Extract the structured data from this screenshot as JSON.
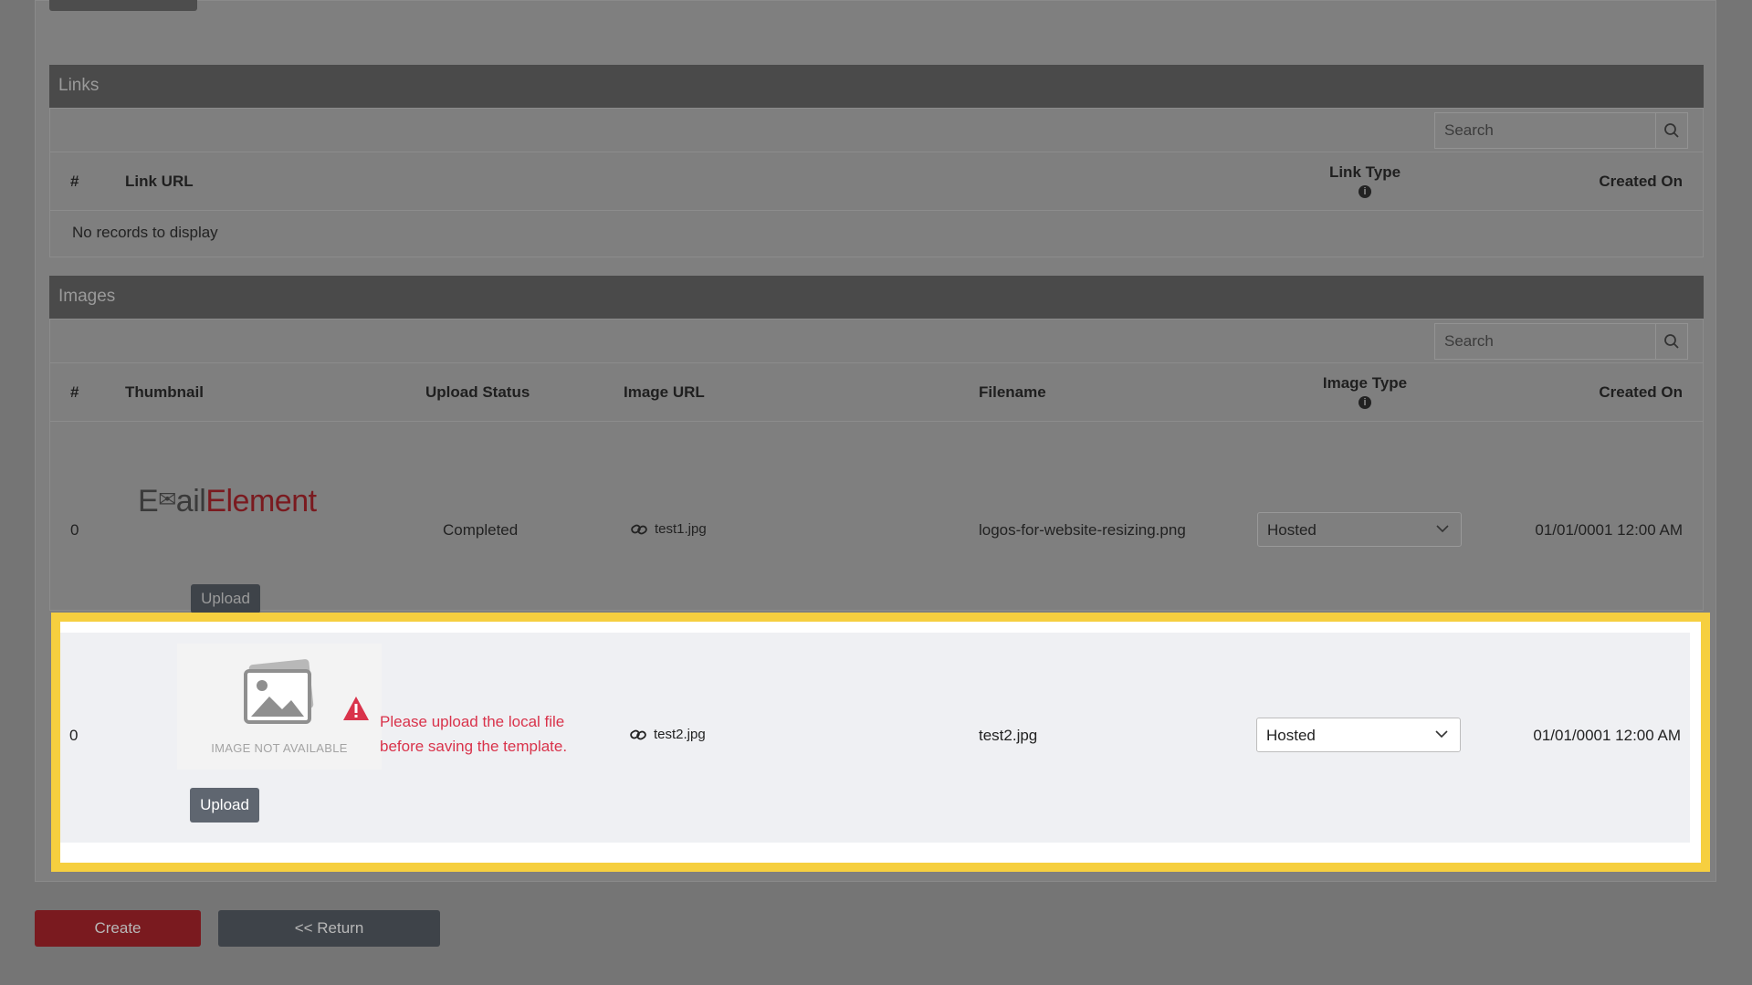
{
  "links_section": {
    "title": "Links",
    "search_placeholder": "Search",
    "columns": {
      "num": "#",
      "url": "Link URL",
      "type": "Link Type",
      "created": "Created On"
    },
    "empty_text": "No records to display"
  },
  "images_section": {
    "title": "Images",
    "search_placeholder": "Search",
    "columns": {
      "num": "#",
      "thumbnail": "Thumbnail",
      "status": "Upload Status",
      "url": "Image URL",
      "filename": "Filename",
      "type": "Image Type",
      "created": "Created On"
    },
    "rows": [
      {
        "num": "0",
        "logo_text_dark": "E",
        "logo_text_dark2": "ail",
        "logo_text_red": "Element",
        "status": "Completed",
        "url": "test1.jpg",
        "filename": "logos-for-website-resizing.png",
        "type": "Hosted",
        "created": "01/01/0001 12:00 AM",
        "upload_label": "Upload"
      },
      {
        "num": "0",
        "placeholder_caption": "IMAGE NOT AVAILABLE",
        "warning_line1": "Please upload the local file",
        "warning_line2": "before saving the template.",
        "url": "test2.jpg",
        "filename": "test2.jpg",
        "type": "Hosted",
        "created": "01/01/0001 12:00 AM",
        "upload_label": "Upload"
      }
    ]
  },
  "footer": {
    "create_label": "Create",
    "return_label": "<< Return"
  },
  "colors": {
    "accent_red": "#7a1a1f",
    "warning": "#d9334b",
    "highlight": "#f6cf3f"
  }
}
